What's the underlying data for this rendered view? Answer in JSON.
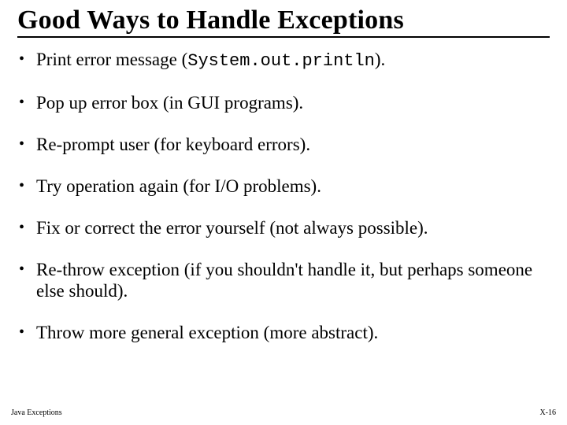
{
  "title": "Good Ways to Handle Exceptions",
  "bullets": [
    {
      "pre": "Print error message  (",
      "code": "System.out.println",
      "post": ")."
    },
    {
      "pre": "Pop up error box  (in GUI programs).",
      "code": "",
      "post": ""
    },
    {
      "pre": "Re-prompt user  (for keyboard errors).",
      "code": "",
      "post": ""
    },
    {
      "pre": "Try operation again  (for I/O problems).",
      "code": "",
      "post": ""
    },
    {
      "pre": "Fix or correct the error yourself (not always possible).",
      "code": "",
      "post": ""
    },
    {
      "pre": "Re-throw exception  (if you shouldn't handle it, but perhaps someone else should).",
      "code": "",
      "post": ""
    },
    {
      "pre": "Throw more general exception (more abstract).",
      "code": "",
      "post": ""
    }
  ],
  "footer": {
    "left": "Java Exceptions",
    "right": "X-16"
  }
}
